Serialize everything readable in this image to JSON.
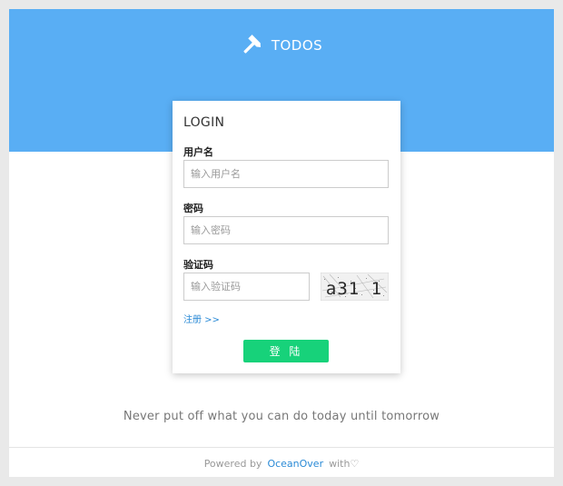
{
  "brand": {
    "icon": "hammer-icon",
    "name": "TODOS"
  },
  "login": {
    "title": "LOGIN",
    "username_label": "用户名",
    "username_placeholder": "输入用户名",
    "password_label": "密码",
    "password_placeholder": "输入密码",
    "captcha_label": "验证码",
    "captcha_placeholder": "输入验证码",
    "captcha_text": "a31 1",
    "register_link": "注册 >>",
    "submit_label": "登 陆"
  },
  "motto": "Never put off what you can do today until tomorrow",
  "footer": {
    "powered_by": "Powered by",
    "link_text": "OceanOver",
    "with_text": "with♡"
  },
  "colors": {
    "banner": "#59aef4",
    "submit_button": "#17d27a",
    "link": "#2a8ad6"
  }
}
